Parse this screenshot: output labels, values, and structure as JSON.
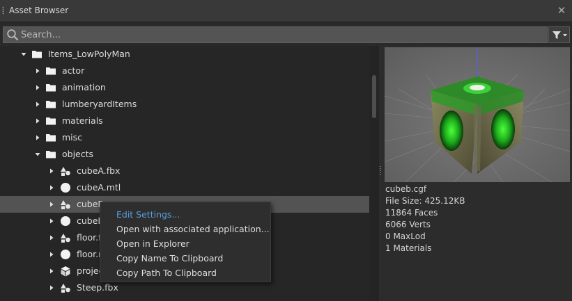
{
  "window": {
    "title": "Asset Browser"
  },
  "search": {
    "placeholder": "Search...",
    "value": ""
  },
  "tree": {
    "rows": [
      {
        "label": "Items_LowPolyMan",
        "type": "folder",
        "expanded": true
      },
      {
        "label": "actor",
        "type": "folder",
        "expanded": false
      },
      {
        "label": "animation",
        "type": "folder",
        "expanded": false
      },
      {
        "label": "lumberyardItems",
        "type": "folder",
        "expanded": false
      },
      {
        "label": "materials",
        "type": "folder",
        "expanded": false
      },
      {
        "label": "misc",
        "type": "folder",
        "expanded": false
      },
      {
        "label": "objects",
        "type": "folder",
        "expanded": true
      },
      {
        "label": "cubeA.fbx",
        "type": "fbx",
        "expanded": false
      },
      {
        "label": "cubeA.mtl",
        "type": "mtl",
        "expanded": false
      },
      {
        "label": "cubeB",
        "type": "fbx",
        "expanded": false,
        "selected": true
      },
      {
        "label": "cubeB",
        "type": "mtl",
        "expanded": false
      },
      {
        "label": "floor.f",
        "type": "fbx",
        "expanded": false
      },
      {
        "label": "floor.m",
        "type": "mtl",
        "expanded": false
      },
      {
        "label": "projec",
        "type": "cube",
        "expanded": false
      },
      {
        "label": "Steep.fbx",
        "type": "fbx",
        "expanded": false
      }
    ]
  },
  "context_menu": {
    "items": [
      {
        "label": "Edit Settings...",
        "active": true
      },
      {
        "label": "Open with associated application..."
      },
      {
        "label": "Open in Explorer"
      },
      {
        "label": "Copy Name To Clipboard"
      },
      {
        "label": "Copy Path To Clipboard"
      }
    ]
  },
  "preview": {
    "info": {
      "filename": "cubeb.cgf",
      "file_size": "File Size: 425.12KB",
      "faces": "11864 Faces",
      "verts": "6066 Verts",
      "maxlod": "0 MaxLod",
      "materials": "1 Materials"
    }
  },
  "colors": {
    "accent": "#5a9fe0",
    "selection": "#535353",
    "panel": "#262626",
    "menu": "#2e2e2e"
  }
}
